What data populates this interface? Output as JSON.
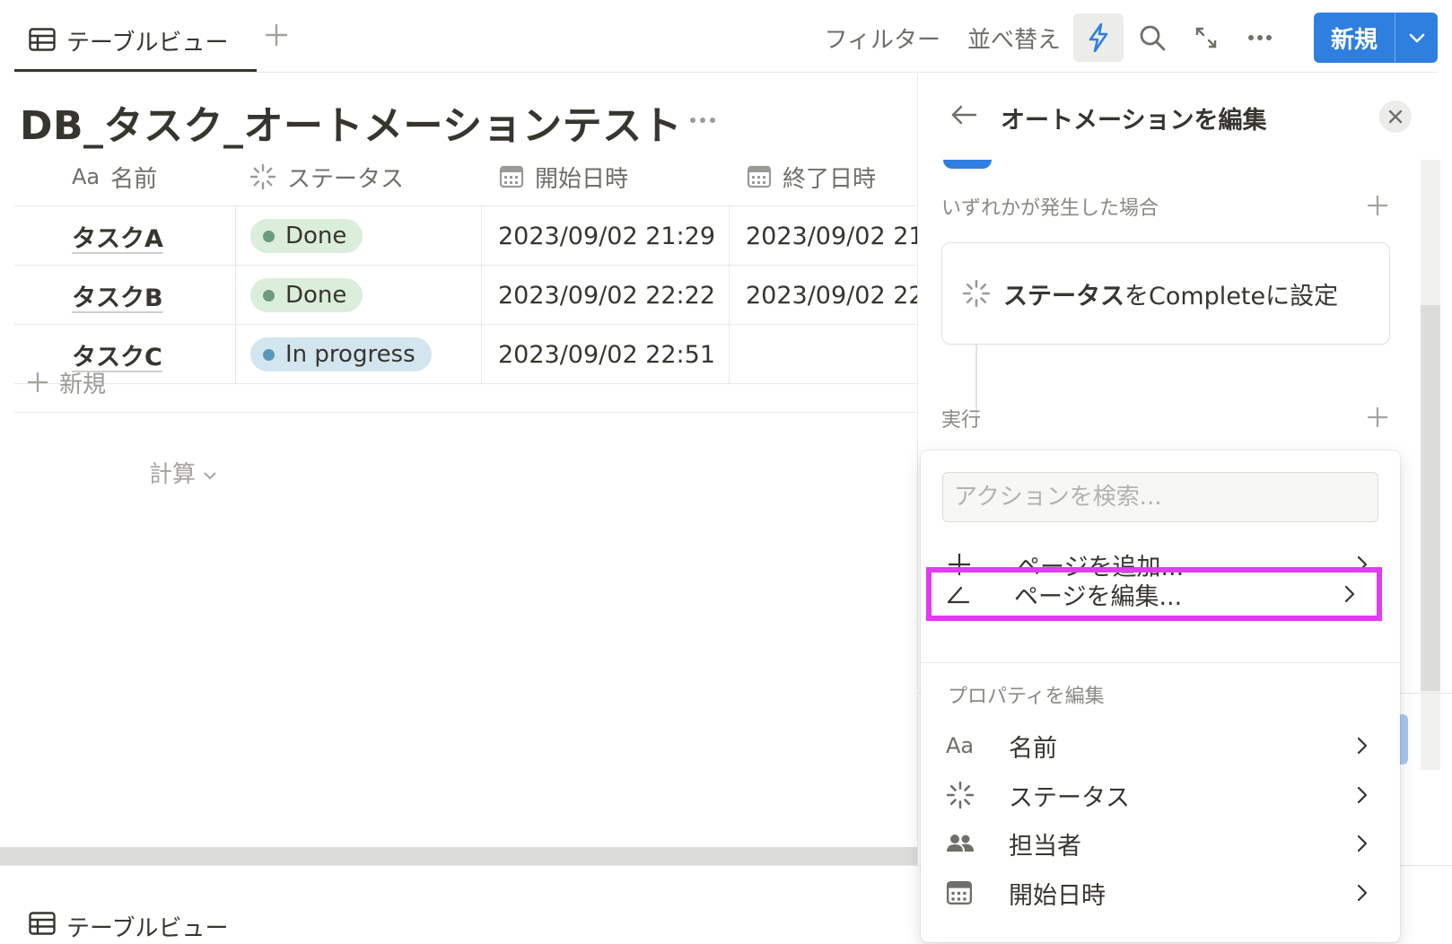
{
  "topbar": {
    "view_tab_label": "テーブルビュー",
    "filter_label": "フィルター",
    "sort_label": "並べ替え",
    "new_button_label": "新規",
    "accent_color": "#2f7fe0"
  },
  "page": {
    "title": "DB_タスク_オートメーションテスト"
  },
  "table": {
    "columns": [
      {
        "label": "名前",
        "icon": "text-property-icon",
        "icon_text": "Aa"
      },
      {
        "label": "ステータス",
        "icon": "status-property-icon"
      },
      {
        "label": "開始日時",
        "icon": "calendar-icon"
      },
      {
        "label": "終了日時",
        "icon": "calendar-icon"
      }
    ],
    "rows": [
      {
        "name": "タスクA",
        "status": "Done",
        "start": "2023/09/02 21:29",
        "end": "2023/09/02 21"
      },
      {
        "name": "タスクB",
        "status": "Done",
        "start": "2023/09/02 22:22",
        "end": "2023/09/02 22"
      },
      {
        "name": "タスクC",
        "status": "In progress",
        "start": "2023/09/02 22:51",
        "end": ""
      }
    ],
    "new_row_label": "新規",
    "calc_label": "計算"
  },
  "status_colors": {
    "done_bg": "#dbeddb",
    "done_dot": "#6c9b7d",
    "in_progress_bg": "#d3e5ef",
    "in_progress_dot": "#5b97bd"
  },
  "bottom": {
    "view_tab_label": "テーブルビュー"
  },
  "panel": {
    "title": "オートメーションを編集",
    "trigger_section_label": "いずれかが発生した場合",
    "trigger": {
      "property": "ステータス",
      "middle": "を",
      "value": "Complete",
      "suffix": "に設定"
    },
    "action_section_label": "実行"
  },
  "dropdown": {
    "search_placeholder": "アクションを検索...",
    "items": [
      {
        "label": "ページを追加...",
        "icon": "plus-icon"
      },
      {
        "label": "ページを編集...",
        "icon": "edit-pencil-icon",
        "highlighted": true,
        "highlight_color": "#e03cf0"
      }
    ],
    "properties_section_label": "プロパティを編集",
    "properties": [
      {
        "label": "名前",
        "icon": "text-property-icon",
        "icon_text": "Aa"
      },
      {
        "label": "ステータス",
        "icon": "status-property-icon"
      },
      {
        "label": "担当者",
        "icon": "people-icon"
      },
      {
        "label": "開始日時",
        "icon": "calendar-icon"
      }
    ]
  }
}
